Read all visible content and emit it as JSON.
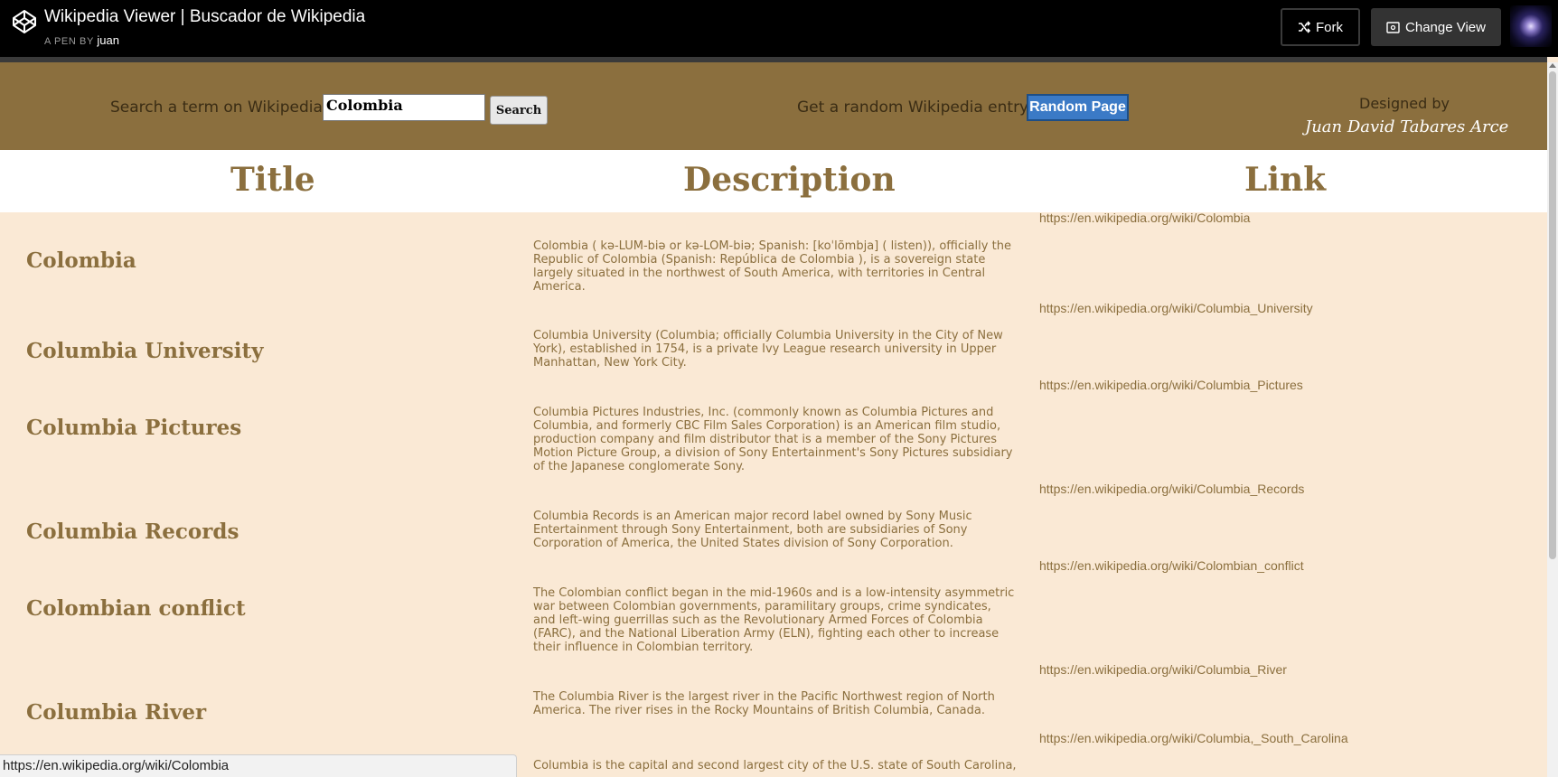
{
  "codepen": {
    "title": "Wikipedia Viewer | Buscador de Wikipedia",
    "by_label": "A PEN BY",
    "author": "juan",
    "fork_label": "Fork",
    "change_view_label": "Change View"
  },
  "search": {
    "label": "Search a term on Wikipedia:",
    "value": "Colombia",
    "button": "Search",
    "random_label": "Get a random Wikipedia entry:",
    "random_button": "Random Page",
    "designed_by": "Designed by",
    "designer": "Juan David Tabares Arce"
  },
  "table": {
    "headers": [
      "Title",
      "Description",
      "Link"
    ],
    "rows": [
      {
        "title": "Colombia",
        "description": "Colombia ( kə-LUM-biə or kə-LOM-biə; Spanish: [koˈlõmbja] ( listen)), officially the Republic of Colombia (Spanish: República de Colombia ), is a sovereign state largely situated in the northwest of South America, with territories in Central America.",
        "link": "https://en.wikipedia.org/wiki/Colombia"
      },
      {
        "title": "Columbia University",
        "description": "Columbia University (Columbia; officially Columbia University in the City of New York), established in 1754, is a private Ivy League research university in Upper Manhattan, New York City.",
        "link": "https://en.wikipedia.org/wiki/Columbia_University"
      },
      {
        "title": "Columbia Pictures",
        "description": "Columbia Pictures Industries, Inc. (commonly known as Columbia Pictures and Columbia, and formerly CBC Film Sales Corporation) is an American film studio, production company and film distributor that is a member of the Sony Pictures Motion Picture Group, a division of Sony Entertainment's Sony Pictures subsidiary of the Japanese conglomerate Sony.",
        "link": "https://en.wikipedia.org/wiki/Columbia_Pictures"
      },
      {
        "title": "Columbia Records",
        "description": "Columbia Records is an American major record label owned by Sony Music Entertainment through Sony Entertainment, both are subsidiaries of Sony Corporation of America, the United States division of Sony Corporation.",
        "link": "https://en.wikipedia.org/wiki/Columbia_Records"
      },
      {
        "title": "Colombian conflict",
        "description": "The Colombian conflict began in the mid-1960s and is a low-intensity asymmetric war between Colombian governments, paramilitary groups, crime syndicates, and left-wing guerrillas such as the Revolutionary Armed Forces of Colombia (FARC), and the National Liberation Army (ELN), fighting each other to increase their influence in Colombian territory.",
        "link": "https://en.wikipedia.org/wiki/Colombian_conflict"
      },
      {
        "title": "Columbia River",
        "description": "The Columbia River is the largest river in the Pacific Northwest region of North America. The river rises in the Rocky Mountains of British Columbia, Canada.",
        "link": "https://en.wikipedia.org/wiki/Columbia_River"
      },
      {
        "title": "",
        "description": "Columbia is the capital and second largest city of the U.S. state of South Carolina,",
        "link": "https://en.wikipedia.org/wiki/Columbia,_South_Carolina"
      }
    ]
  },
  "status_bar": {
    "url": "https://en.wikipedia.org/wiki/Colombia"
  },
  "colors": {
    "topbar": "#000000",
    "search_band": "#8b6f3e",
    "accent_text": "#8b6f3e",
    "content_bg": "#fae9d5",
    "random_button": "#3b7ac6"
  },
  "icons": [
    "codepen-logo-icon",
    "fork-icon",
    "change-view-icon",
    "user-avatar"
  ]
}
